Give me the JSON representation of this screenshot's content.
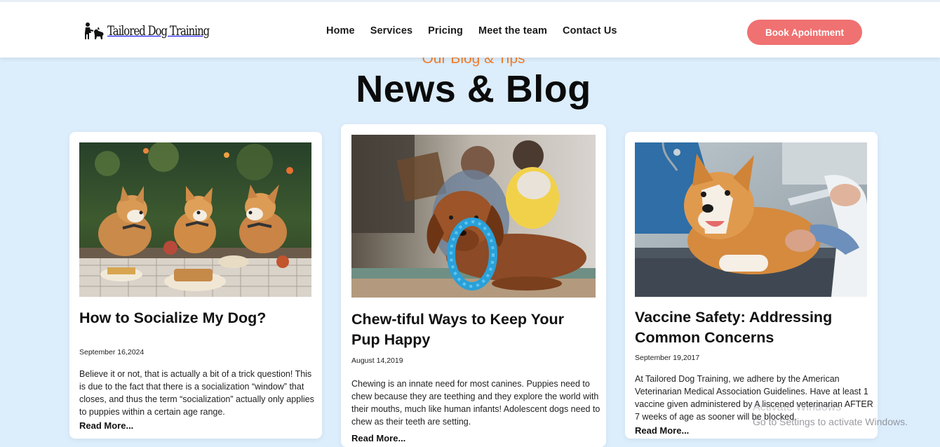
{
  "brand": {
    "name": "Tailored Dog Training"
  },
  "nav": {
    "items": [
      {
        "label": "Home"
      },
      {
        "label": "Services"
      },
      {
        "label": "Pricing"
      },
      {
        "label": "Meet the team"
      },
      {
        "label": "Contact Us"
      }
    ],
    "cta_label": "Book Apointment"
  },
  "section": {
    "eyebrow": "Our Blog & Tips",
    "title": "News & Blog"
  },
  "posts": [
    {
      "title": "How to Socialize My Dog?",
      "date": "September 16,2024",
      "excerpt": "Believe it or not, that is actually a bit of a trick question! This is due to the fact that there is a socialization “window” that closes, and thus the term “socialization” actually only applies to puppies within a certain age range.",
      "read_more": "Read More..."
    },
    {
      "title": "Chew-tiful Ways to Keep Your Pup Happy",
      "date": "August 14,2019",
      "excerpt": "Chewing is an innate need for most canines. Puppies need to chew because they are teething and they explore the world with their mouths, much like human infants! Adolescent dogs need to chew as their teeth are setting.",
      "read_more": "Read More..."
    },
    {
      "title": "Vaccine Safety: Addressing Common Concerns",
      "date": "September 19,2017",
      "excerpt": "At Tailored Dog Training, we adhere by the American Veterinarian Medical Association Guidelines. Have at least 1 vaccine given administered by A liscened veterinarian AFTER 7 weeks of age as sooner will be blocked.",
      "read_more": "Read More..."
    }
  ],
  "os_overlay": {
    "line1": "Activate Windows",
    "line2": "Go to Settings to activate Windows."
  },
  "colors": {
    "page_bg": "#dcedfc",
    "accent": "#f07171",
    "eyebrow": "#f07d2a"
  }
}
